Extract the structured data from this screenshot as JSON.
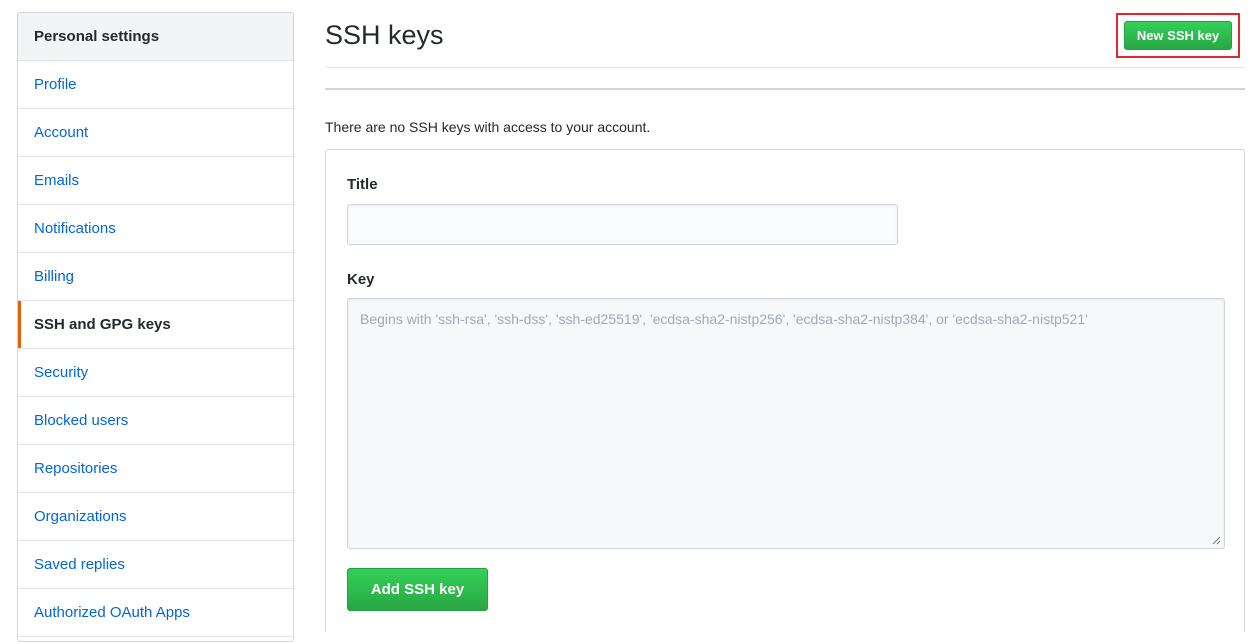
{
  "sidebar": {
    "header": "Personal settings",
    "items": [
      {
        "label": "Profile"
      },
      {
        "label": "Account"
      },
      {
        "label": "Emails"
      },
      {
        "label": "Notifications"
      },
      {
        "label": "Billing"
      },
      {
        "label": "SSH and GPG keys",
        "selected": true
      },
      {
        "label": "Security"
      },
      {
        "label": "Blocked users"
      },
      {
        "label": "Repositories"
      },
      {
        "label": "Organizations"
      },
      {
        "label": "Saved replies"
      },
      {
        "label": "Authorized OAuth Apps"
      }
    ]
  },
  "main": {
    "title": "SSH keys",
    "new_key_button": "New SSH key",
    "empty_message": "There are no SSH keys with access to your account.",
    "form": {
      "title_label": "Title",
      "title_value": "",
      "key_label": "Key",
      "key_placeholder": "Begins with 'ssh-rsa', 'ssh-dss', 'ssh-ed25519', 'ecdsa-sha2-nistp256', 'ecdsa-sha2-nistp384', or 'ecdsa-sha2-nistp521'",
      "submit_button": "Add SSH key"
    }
  },
  "colors": {
    "accent_green": "#28a745",
    "link_blue": "#0366d6",
    "selected_marker": "#e36209",
    "highlight_box": "#e4262c"
  }
}
